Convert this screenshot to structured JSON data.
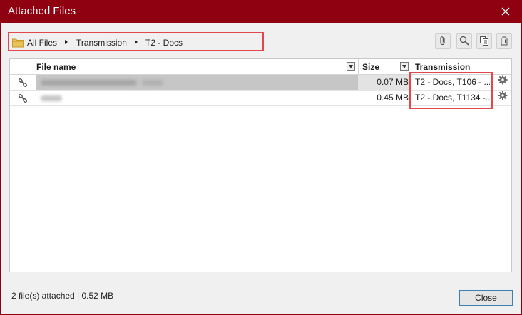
{
  "window": {
    "title": "Attached Files"
  },
  "breadcrumb": {
    "items": [
      "All Files",
      "Transmission",
      "T2 - Docs"
    ]
  },
  "toolbar": {
    "icons": [
      "paperclip-icon",
      "search-icon",
      "copy-icon",
      "trash-icon"
    ]
  },
  "grid": {
    "columns": [
      "File name",
      "Size",
      "Transmission"
    ],
    "rows": [
      {
        "name": "",
        "size": "0.07 MB",
        "transmission": "T2 - Docs, T106 - ...",
        "selected": true
      },
      {
        "name": "",
        "size": "0.45 MB",
        "transmission": "T2 - Docs, T1134 -...",
        "selected": false
      }
    ]
  },
  "status": {
    "text": "2 file(s) attached | 0.52 MB"
  },
  "buttons": {
    "close_label": "Close"
  },
  "colors": {
    "titlebar": "#8f0010",
    "highlight": "#e1484c",
    "selected_row": "#c6c6c6"
  }
}
